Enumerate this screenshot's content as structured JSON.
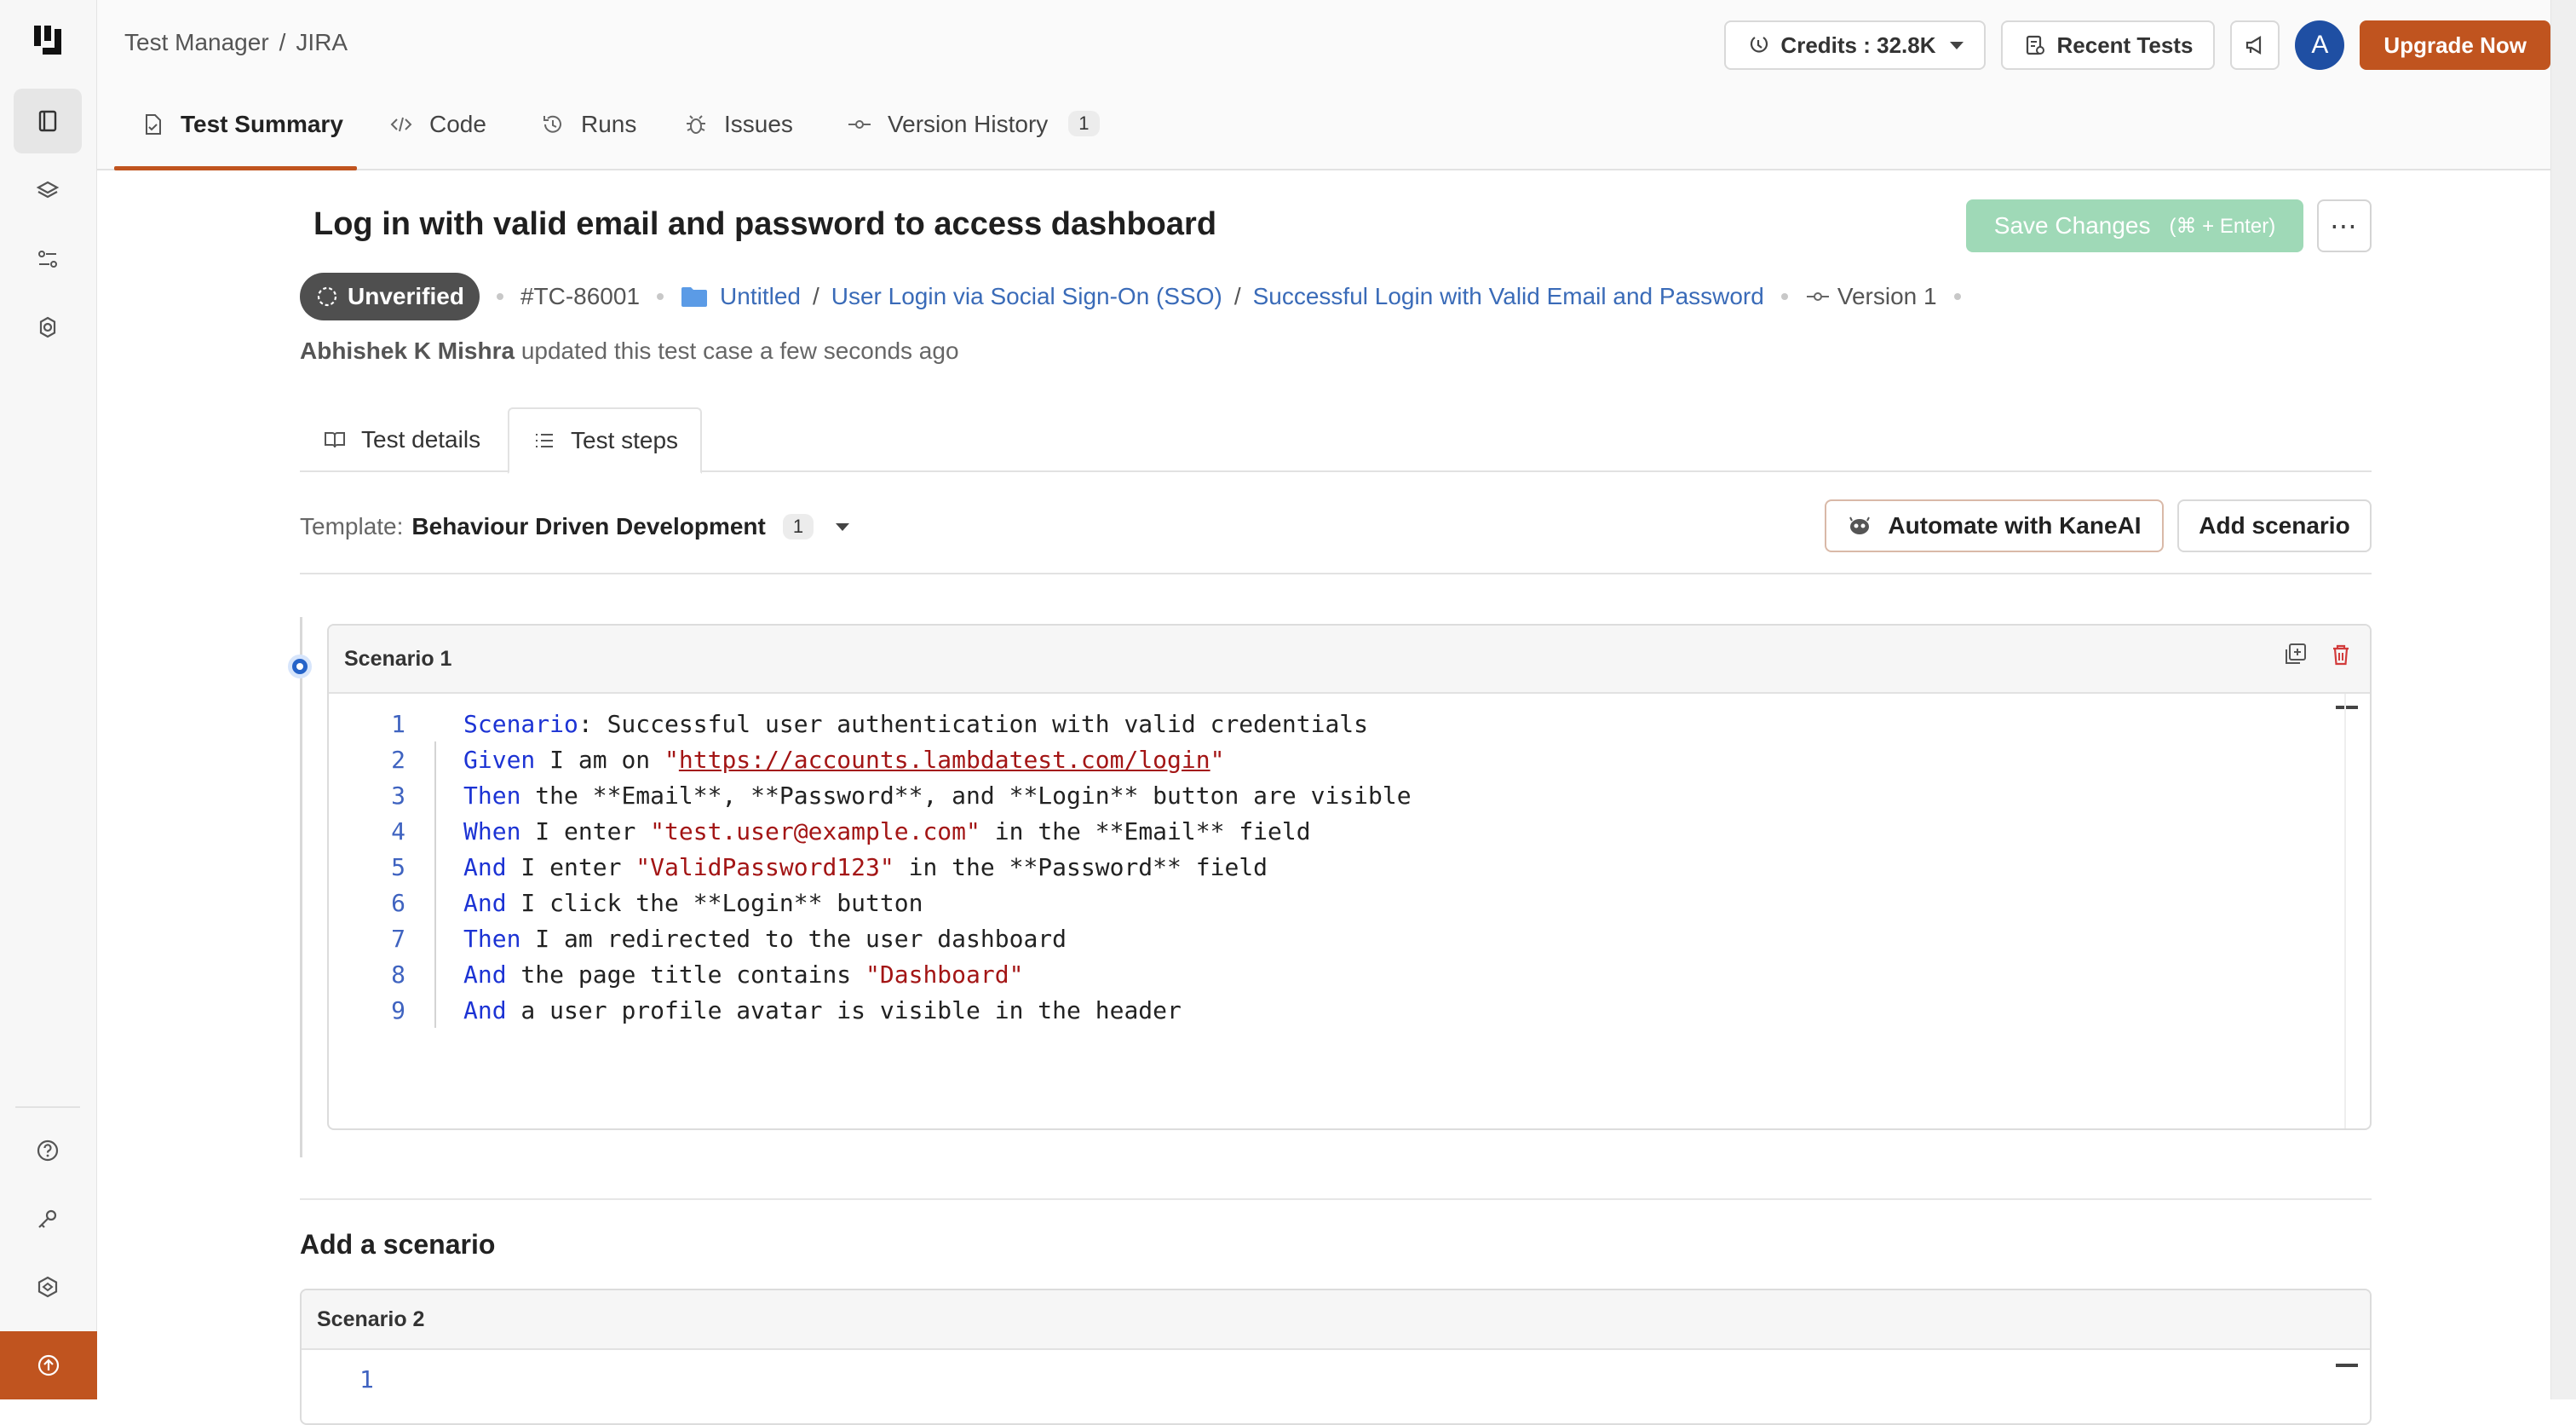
{
  "breadcrumb": {
    "app": "Test Manager",
    "separator": "/",
    "project": "JIRA"
  },
  "header": {
    "credits_label": "Credits : 32.8K",
    "recent_tests_label": "Recent Tests",
    "avatar_initial": "A",
    "upgrade_label": "Upgrade Now",
    "accent_color": "#c0541f"
  },
  "main_tabs": [
    {
      "label": "Test Summary",
      "icon": "test-summary-icon",
      "active": true
    },
    {
      "label": "Code",
      "icon": "code-icon"
    },
    {
      "label": "Runs",
      "icon": "history-icon"
    },
    {
      "label": "Issues",
      "icon": "bug-icon"
    },
    {
      "label": "Version History",
      "icon": "commit-icon",
      "count": "1"
    }
  ],
  "test_case": {
    "title": "Log in with valid email and password to access dashboard",
    "status": "Unverified",
    "id": "#TC-86001",
    "path": [
      "Untitled",
      "User Login via Social Sign-On (SSO)",
      "Successful Login with Valid Email and Password"
    ],
    "path_separator": "/",
    "version": "Version 1",
    "updated_by": "Abhishek K Mishra",
    "updated_text": "updated this test case a few seconds ago"
  },
  "actions": {
    "save_label": "Save Changes",
    "save_shortcut": "(⌘ + Enter)",
    "more_label": "⋯"
  },
  "inner_tabs": [
    {
      "label": "Test details",
      "icon": "book-icon"
    },
    {
      "label": "Test steps",
      "icon": "list-icon",
      "active": true
    }
  ],
  "template": {
    "label": "Template:",
    "value": "Behaviour Driven Development",
    "count": "1",
    "automate_label": "Automate with KaneAI",
    "add_scenario_label": "Add scenario"
  },
  "scenario1": {
    "title": "Scenario 1",
    "lines": [
      {
        "n": "1",
        "guide": false,
        "parts": [
          [
            "kw",
            "Scenario"
          ],
          [
            "txt",
            ": Successful user authentication with valid credentials"
          ]
        ]
      },
      {
        "n": "2",
        "guide": true,
        "parts": [
          [
            "kw",
            "Given"
          ],
          [
            "txt",
            " I am on "
          ],
          [
            "str",
            "\""
          ],
          [
            "link",
            "https://accounts.lambdatest.com/login"
          ],
          [
            "str",
            "\""
          ]
        ]
      },
      {
        "n": "3",
        "guide": true,
        "parts": [
          [
            "kw",
            "Then"
          ],
          [
            "txt",
            " the **Email**, **Password**, and **Login** button are visible"
          ]
        ]
      },
      {
        "n": "4",
        "guide": true,
        "parts": [
          [
            "kw",
            "When"
          ],
          [
            "txt",
            " I enter "
          ],
          [
            "str",
            "\"test.user@example.com\""
          ],
          [
            "txt",
            " in the **Email** field"
          ]
        ]
      },
      {
        "n": "5",
        "guide": true,
        "parts": [
          [
            "kw",
            "And"
          ],
          [
            "txt",
            " I enter "
          ],
          [
            "str",
            "\"ValidPassword123\""
          ],
          [
            "txt",
            " in the **Password** field"
          ]
        ]
      },
      {
        "n": "6",
        "guide": true,
        "parts": [
          [
            "kw",
            "And"
          ],
          [
            "txt",
            " I click the **Login** button"
          ]
        ]
      },
      {
        "n": "7",
        "guide": true,
        "parts": [
          [
            "kw",
            "Then"
          ],
          [
            "txt",
            " I am redirected to the user dashboard"
          ]
        ]
      },
      {
        "n": "8",
        "guide": true,
        "parts": [
          [
            "kw",
            "And"
          ],
          [
            "txt",
            " the page title contains "
          ],
          [
            "str",
            "\"Dashboard\""
          ]
        ]
      },
      {
        "n": "9",
        "guide": true,
        "parts": [
          [
            "kw",
            "And"
          ],
          [
            "txt",
            " a user profile avatar is visible in the header"
          ]
        ]
      }
    ]
  },
  "add_scenario": {
    "title": "Add a scenario",
    "scenario2_title": "Scenario 2",
    "first_line": "1"
  }
}
